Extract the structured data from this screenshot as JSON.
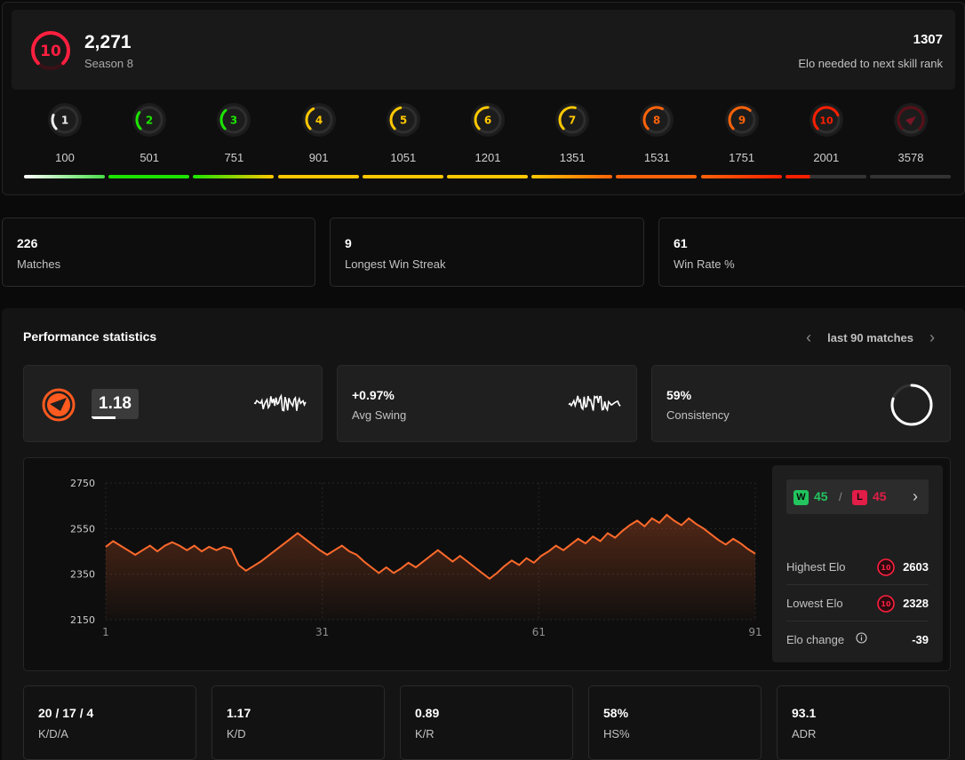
{
  "hero": {
    "level": "10",
    "elo": "2,271",
    "season": "Season 8",
    "elo_needed_value": "1307",
    "elo_needed_label": "Elo needed to next skill rank"
  },
  "levels": [
    {
      "level": "1",
      "min": "100",
      "color": "#eeeeee",
      "progress": 0.25
    },
    {
      "level": "2",
      "min": "501",
      "color": "#1ce400",
      "progress": 0.3
    },
    {
      "level": "3",
      "min": "751",
      "color": "#1ce400",
      "progress": 0.35
    },
    {
      "level": "4",
      "min": "901",
      "color": "#ffc800",
      "progress": 0.4
    },
    {
      "level": "5",
      "min": "1051",
      "color": "#ffc800",
      "progress": 0.45
    },
    {
      "level": "6",
      "min": "1201",
      "color": "#ffc800",
      "progress": 0.5
    },
    {
      "level": "7",
      "min": "1351",
      "color": "#ffc800",
      "progress": 0.55
    },
    {
      "level": "8",
      "min": "1531",
      "color": "#ff6309",
      "progress": 0.6
    },
    {
      "level": "9",
      "min": "1751",
      "color": "#ff6309",
      "progress": 0.65
    },
    {
      "level": "10",
      "min": "2001",
      "color": "#fe1f00",
      "progress": 0.75
    },
    {
      "level": "",
      "min": "3578",
      "color": "#5a0f18",
      "progress": 1.0
    }
  ],
  "level_bars": [
    {
      "from": "#ffffff",
      "to": "#4ade4a"
    },
    {
      "from": "#1ce400",
      "to": "#1ce400"
    },
    {
      "from": "#1ce400",
      "to": "#ffc800"
    },
    {
      "from": "#ffc800",
      "to": "#ffc800"
    },
    {
      "from": "#ffc800",
      "to": "#ffc800"
    },
    {
      "from": "#ffc800",
      "to": "#ffc800"
    },
    {
      "from": "#ffc800",
      "to": "#ff6309"
    },
    {
      "from": "#ff6309",
      "to": "#ff6309"
    },
    {
      "from": "#ff6309",
      "to": "#fe1f00"
    },
    {
      "from": "#fe1f00",
      "to": "#fe1f00",
      "fill": 0.3,
      "rest": "#333333"
    },
    {
      "from": "#333333",
      "to": "#333333"
    }
  ],
  "stats": [
    {
      "value": "226",
      "label": "Matches"
    },
    {
      "value": "9",
      "label": "Longest Win Streak"
    },
    {
      "value": "61",
      "label": "Win Rate %"
    }
  ],
  "performance": {
    "title": "Performance statistics",
    "period": "last 90 matches",
    "rating": {
      "value": "1.18",
      "fill": 0.5
    },
    "avg_swing": {
      "value": "+0.97%",
      "label": "Avg Swing"
    },
    "consistency": {
      "value": "59%",
      "label": "Consistency",
      "fraction": 0.59
    }
  },
  "elo_side": {
    "wins": "45",
    "wins_letter": "W",
    "sep": "/",
    "losses": "45",
    "losses_letter": "L",
    "highest_label": "Highest Elo",
    "highest_value": "2603",
    "lowest_label": "Lowest Elo",
    "lowest_value": "2328",
    "change_label": "Elo change",
    "change_value": "-39",
    "mini_level": "10"
  },
  "chart_data": {
    "type": "area",
    "x": [
      1,
      2,
      3,
      4,
      5,
      6,
      7,
      8,
      9,
      10,
      11,
      12,
      13,
      14,
      15,
      16,
      17,
      18,
      19,
      20,
      21,
      22,
      23,
      24,
      25,
      26,
      27,
      28,
      29,
      30,
      31,
      32,
      33,
      34,
      35,
      36,
      37,
      38,
      39,
      40,
      41,
      42,
      43,
      44,
      45,
      46,
      47,
      48,
      49,
      50,
      51,
      52,
      53,
      54,
      55,
      56,
      57,
      58,
      59,
      60,
      61,
      62,
      63,
      64,
      65,
      66,
      67,
      68,
      69,
      70,
      71,
      72,
      73,
      74,
      75,
      76,
      77,
      78,
      79,
      80,
      81,
      82,
      83,
      84,
      85,
      86,
      87,
      88,
      89,
      90,
      91
    ],
    "values": [
      2470,
      2495,
      2475,
      2455,
      2435,
      2455,
      2475,
      2450,
      2475,
      2490,
      2475,
      2455,
      2475,
      2450,
      2470,
      2455,
      2470,
      2460,
      2390,
      2365,
      2385,
      2405,
      2430,
      2455,
      2480,
      2505,
      2530,
      2505,
      2480,
      2455,
      2435,
      2455,
      2475,
      2450,
      2435,
      2405,
      2380,
      2355,
      2380,
      2355,
      2375,
      2400,
      2380,
      2405,
      2430,
      2455,
      2430,
      2405,
      2430,
      2405,
      2380,
      2355,
      2330,
      2355,
      2385,
      2410,
      2390,
      2420,
      2400,
      2430,
      2450,
      2475,
      2455,
      2480,
      2505,
      2485,
      2515,
      2495,
      2530,
      2510,
      2540,
      2565,
      2585,
      2560,
      2595,
      2575,
      2610,
      2585,
      2565,
      2595,
      2570,
      2550,
      2525,
      2500,
      2480,
      2505,
      2485,
      2460,
      2440
    ],
    "xticks": [
      "1",
      "31",
      "61",
      "91"
    ],
    "yticks": [
      "2150",
      "2350",
      "2550",
      "2750"
    ],
    "ylim": [
      2150,
      2750
    ],
    "xlim": [
      1,
      91
    ],
    "line_color": "#ff6a2c",
    "grid": true
  },
  "bottom_stats": [
    {
      "value": "20 / 17 / 4",
      "label": "K/D/A"
    },
    {
      "value": "1.17",
      "label": "K/D"
    },
    {
      "value": "0.89",
      "label": "K/R"
    },
    {
      "value": "58%",
      "label": "HS%"
    },
    {
      "value": "93.1",
      "label": "ADR"
    }
  ],
  "icons": {
    "rating": "faceit-logo-icon",
    "consistency": "progress-ring-icon",
    "info": "info-icon",
    "chevron": "chevron-right-icon"
  }
}
